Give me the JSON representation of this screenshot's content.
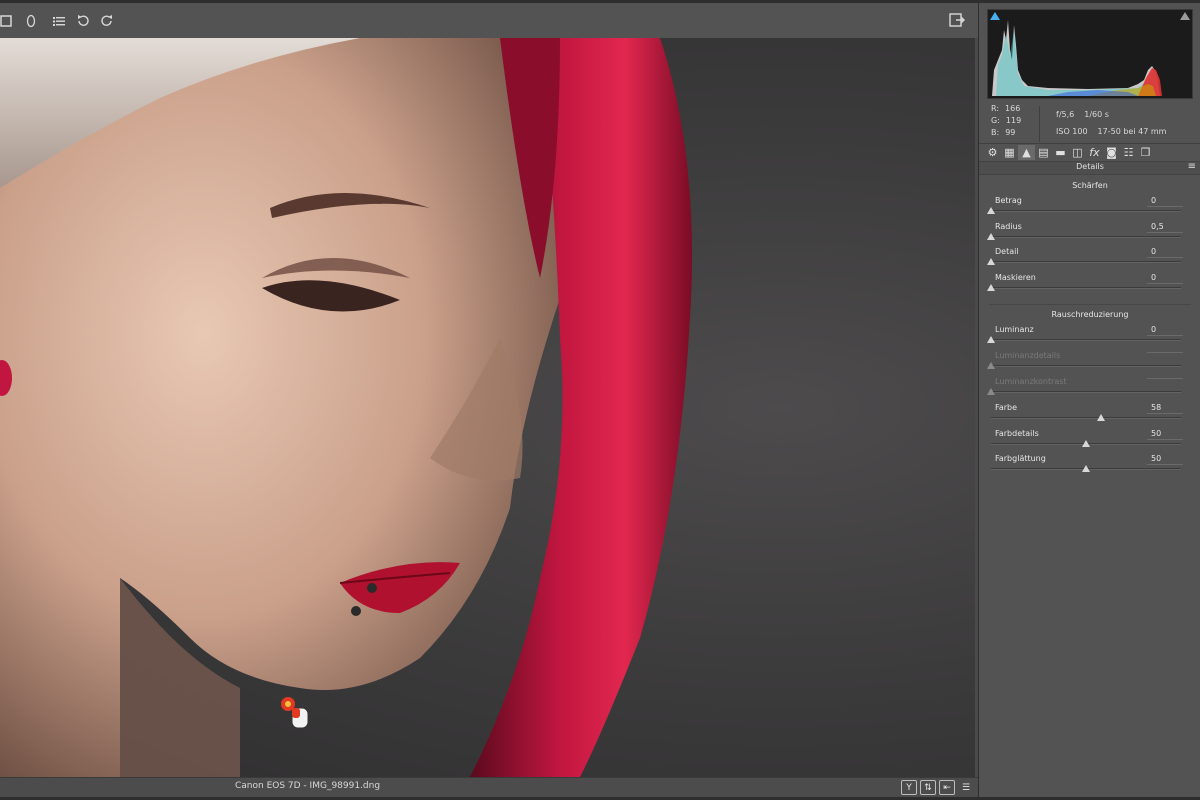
{
  "toolbar": {
    "icons": [
      "crop-icon",
      "redeye-icon",
      "presets-list-icon",
      "rotate-left-icon",
      "rotate-right-icon"
    ],
    "right_icon": "fullscreen-icon"
  },
  "status": {
    "filename": "Canon EOS 7D - IMG_98991.dng",
    "btn_y": "Y"
  },
  "info": {
    "r_label": "R:",
    "r_value": "166",
    "g_label": "G:",
    "g_value": "119",
    "b_label": "B:",
    "b_value": "99",
    "aperture": "f/5,6",
    "shutter": "1/60 s",
    "iso": "ISO 100",
    "lens": "17-50 bei 47 mm"
  },
  "panel": {
    "title": "Details",
    "section_sharpen": "Schärfen",
    "section_noise": "Rauschreduzierung",
    "sliders": [
      {
        "label": "Betrag",
        "value": "0",
        "pos": 0,
        "enabled": true
      },
      {
        "label": "Radius",
        "value": "0,5",
        "pos": 0,
        "enabled": true
      },
      {
        "label": "Detail",
        "value": "0",
        "pos": 0,
        "enabled": true
      },
      {
        "label": "Maskieren",
        "value": "0",
        "pos": 0,
        "enabled": true
      },
      {
        "label": "Luminanz",
        "value": "0",
        "pos": 0,
        "enabled": true
      },
      {
        "label": "Luminanzdetails",
        "value": "",
        "pos": 0,
        "enabled": false
      },
      {
        "label": "Luminanzkontrast",
        "value": "",
        "pos": 0,
        "enabled": false
      },
      {
        "label": "Farbe",
        "value": "58",
        "pos": 0.58,
        "enabled": true
      },
      {
        "label": "Farbdetails",
        "value": "50",
        "pos": 0.5,
        "enabled": true
      },
      {
        "label": "Farbglättung",
        "value": "50",
        "pos": 0.5,
        "enabled": true
      }
    ]
  },
  "colors": {
    "panel_bg": "#535353",
    "canvas_bg": "#3b3a3b",
    "hair_red": "#b0123a",
    "accent_blue": "#46b0ee"
  }
}
